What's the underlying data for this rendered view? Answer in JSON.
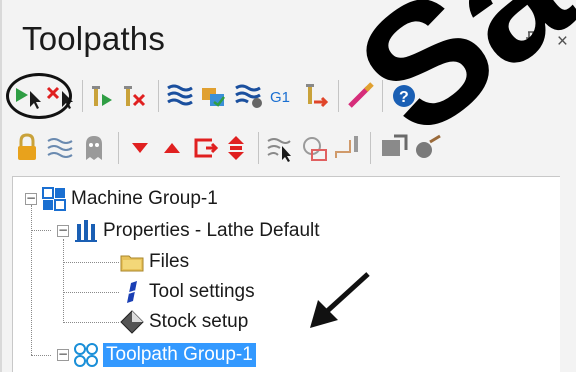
{
  "panel": {
    "title": "Toolpaths",
    "controls": {
      "dropdown": "▾",
      "pin": "ꟷ",
      "close": "×"
    }
  },
  "toolbar1": [
    "select-all-operations-icon",
    "select-all-dirty-operations-icon",
    "regenerate-selected-icon",
    "regenerate-dirty-icon",
    "backplot-icon",
    "verify-icon",
    "simulator-icon",
    "post-g1-icon",
    "highfeed-icon",
    "lock-edit-icon",
    "help-icon"
  ],
  "toolbar2": [
    "lock-icon",
    "toggle-display-icon",
    "toggle-posting-icon",
    "move-down-icon",
    "move-up-icon",
    "move-insert-arrow-icon",
    "scroll-to-insert-icon",
    "display-selected-icon",
    "display-only-icon",
    "tool-display-icon",
    "stock-model-icon",
    "verify-check-icon"
  ],
  "post_label": "G1",
  "tree": {
    "machine_group": "Machine Group-1",
    "properties": "Properties - Lathe Default",
    "files": "Files",
    "tool_settings": "Tool settings",
    "stock_setup": "Stock setup",
    "toolpath_group": "Toolpath Group-1"
  },
  "watermark": "Sample",
  "colors": {
    "selection": "#3399ff",
    "accent_red": "#e02020",
    "accent_blue": "#1a6fd1"
  }
}
